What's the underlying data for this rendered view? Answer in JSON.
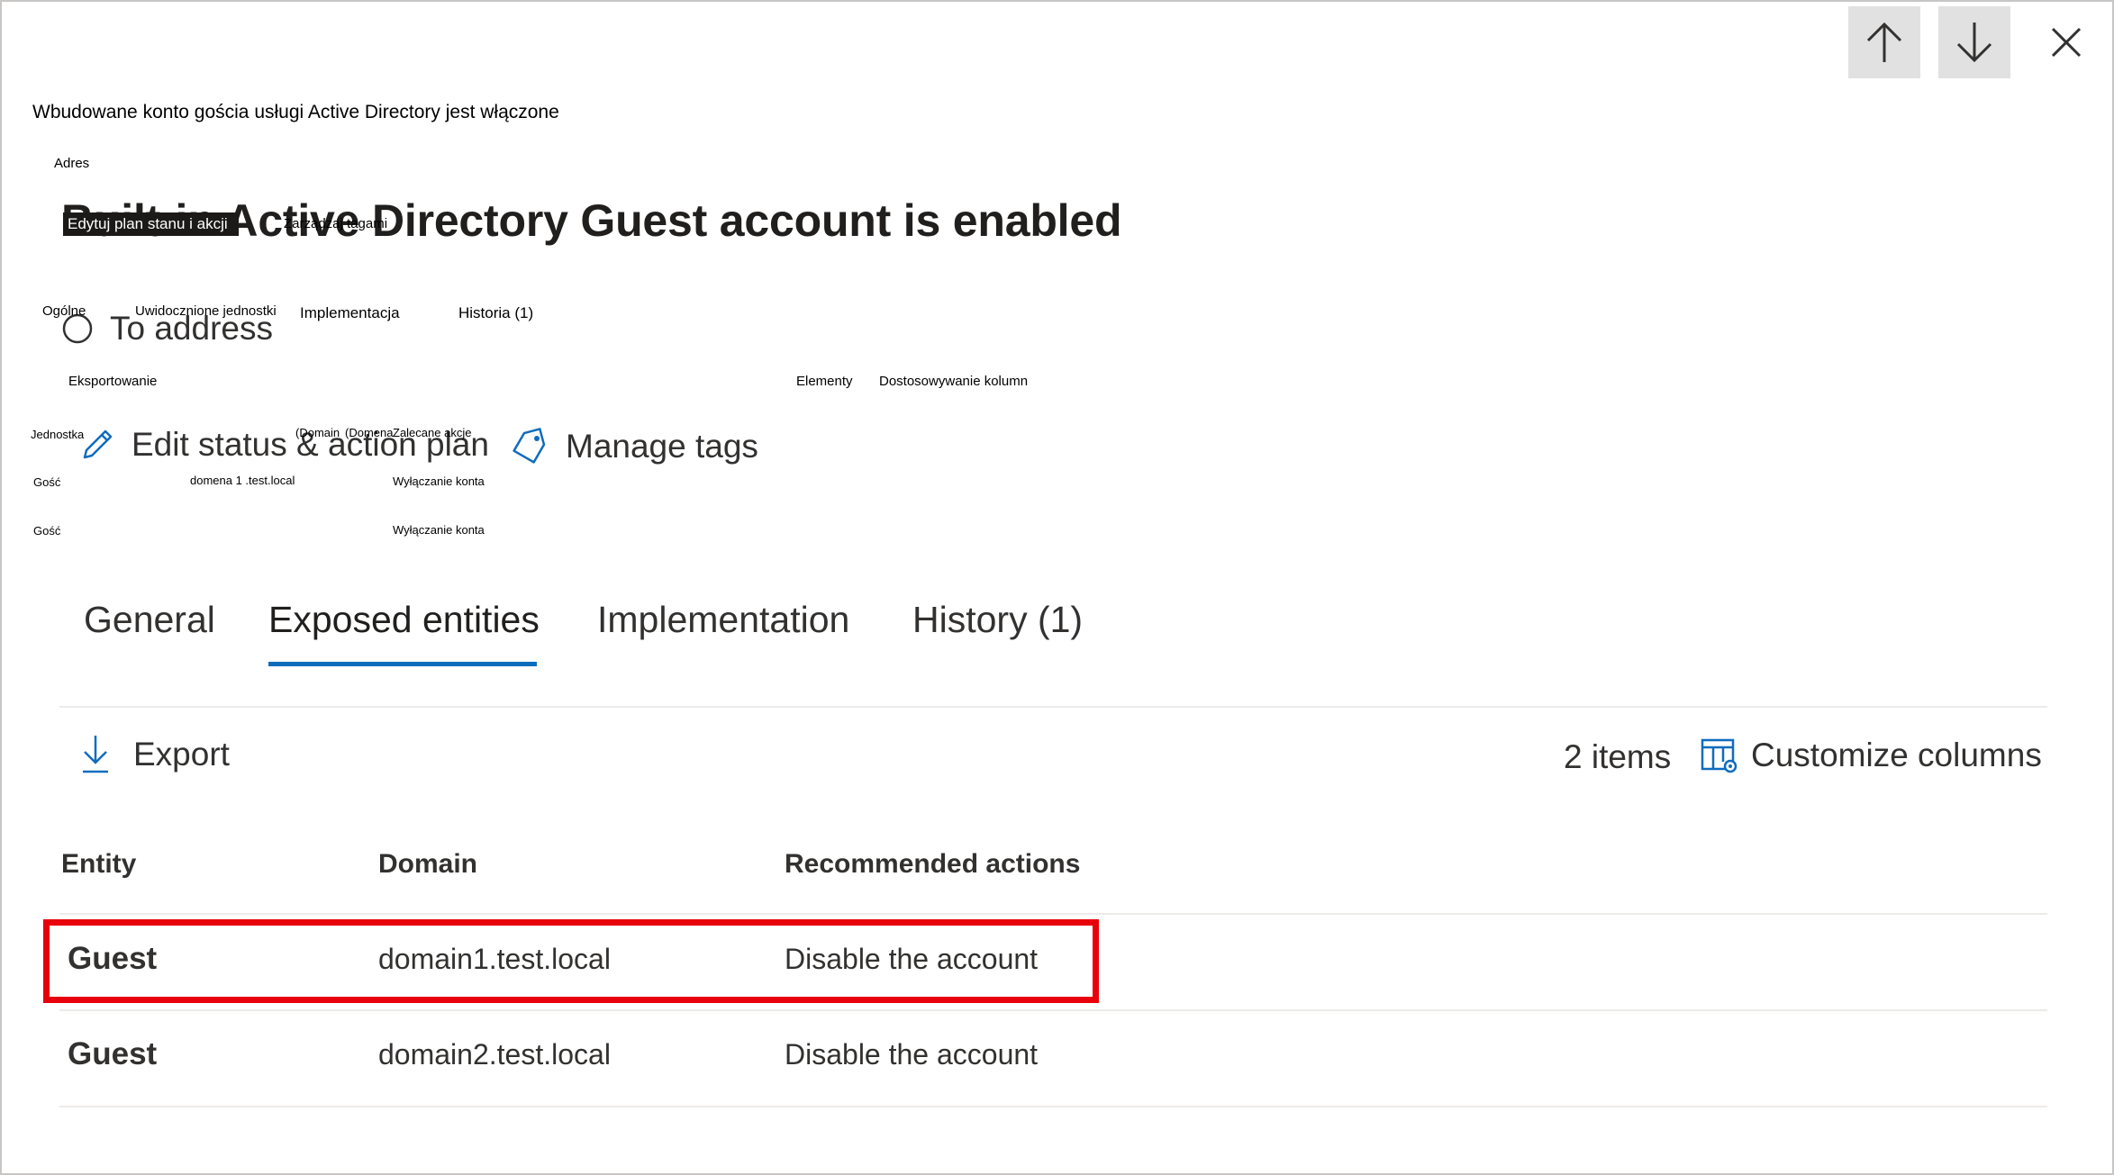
{
  "overlay": {
    "subtitle_pl": "Wbudowane konto gościa usługi Active Directory jest włączone",
    "address_pl": "Adres",
    "edit_plan_pl": "Edytuj plan stanu i akcji",
    "manage_tags_pl": "Zarządzaj tagami",
    "tab_general_pl": "Ogólne",
    "tab_exposed_pl": "Uwidocznione jednostki",
    "tab_impl_pl": "Implementacja",
    "tab_history_pl": "Historia (1)",
    "export_pl": "Eksportowanie",
    "items_pl": "Elementy",
    "customize_pl": "Dostosowywanie kolumn",
    "col_entity_pl": "Jednostka",
    "col_domain_a_pl": "(Domain",
    "col_domain_b_pl": "(Domena",
    "col_actions_pl": "Zalecane akcje",
    "rows": [
      {
        "entity": "Gość",
        "domain": "domena 1 .test.local",
        "action": "Wyłączanie konta"
      },
      {
        "entity": "Gość",
        "domain": "",
        "action": "Wyłączanie konta"
      }
    ]
  },
  "header": {
    "title": "Built-in Active Directory Guest account is enabled",
    "status": "To address",
    "edit_status": "Edit status & action plan",
    "manage_tags": "Manage tags"
  },
  "tabs": [
    {
      "label": "General",
      "active": false
    },
    {
      "label": "Exposed entities",
      "active": true
    },
    {
      "label": "Implementation",
      "active": false
    },
    {
      "label": "History (1)",
      "active": false
    }
  ],
  "toolbar": {
    "export": "Export",
    "items_count": "2 items",
    "customize": "Customize columns"
  },
  "table": {
    "columns": [
      "Entity",
      "Domain",
      "Recommended actions"
    ],
    "rows": [
      {
        "entity": "Guest",
        "domain": "domain1.test.local",
        "action": "Disable the account",
        "highlighted": true
      },
      {
        "entity": "Guest",
        "domain": "domain2.test.local",
        "action": "Disable the account",
        "highlighted": false
      }
    ]
  },
  "colors": {
    "accent": "#0f6cbd",
    "highlight": "#e8000b"
  }
}
